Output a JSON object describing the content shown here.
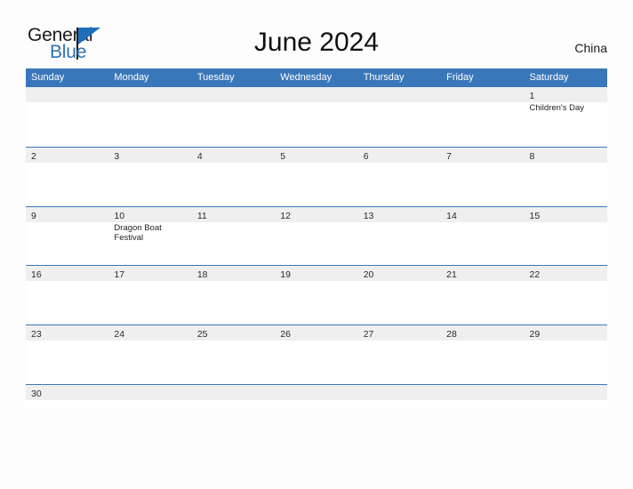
{
  "brand": {
    "name_part1": "General",
    "name_part2": "Blue",
    "triangle_icon": "triangle-icon"
  },
  "header": {
    "title": "June 2024",
    "country": "China"
  },
  "colors": {
    "header_blue": "#3a77ba",
    "brand_blue": "#2e72b5",
    "band_gray": "#efefef",
    "page_background": "#fdfdfd"
  },
  "calendar": {
    "weekdays": [
      "Sunday",
      "Monday",
      "Tuesday",
      "Wednesday",
      "Thursday",
      "Friday",
      "Saturday"
    ],
    "weeks": [
      [
        {
          "date": "",
          "events": []
        },
        {
          "date": "",
          "events": []
        },
        {
          "date": "",
          "events": []
        },
        {
          "date": "",
          "events": []
        },
        {
          "date": "",
          "events": []
        },
        {
          "date": "",
          "events": []
        },
        {
          "date": "1",
          "events": [
            "Children's Day"
          ]
        }
      ],
      [
        {
          "date": "2",
          "events": []
        },
        {
          "date": "3",
          "events": []
        },
        {
          "date": "4",
          "events": []
        },
        {
          "date": "5",
          "events": []
        },
        {
          "date": "6",
          "events": []
        },
        {
          "date": "7",
          "events": []
        },
        {
          "date": "8",
          "events": []
        }
      ],
      [
        {
          "date": "9",
          "events": []
        },
        {
          "date": "10",
          "events": [
            "Dragon Boat Festival"
          ]
        },
        {
          "date": "11",
          "events": []
        },
        {
          "date": "12",
          "events": []
        },
        {
          "date": "13",
          "events": []
        },
        {
          "date": "14",
          "events": []
        },
        {
          "date": "15",
          "events": []
        }
      ],
      [
        {
          "date": "16",
          "events": []
        },
        {
          "date": "17",
          "events": []
        },
        {
          "date": "18",
          "events": []
        },
        {
          "date": "19",
          "events": []
        },
        {
          "date": "20",
          "events": []
        },
        {
          "date": "21",
          "events": []
        },
        {
          "date": "22",
          "events": []
        }
      ],
      [
        {
          "date": "23",
          "events": []
        },
        {
          "date": "24",
          "events": []
        },
        {
          "date": "25",
          "events": []
        },
        {
          "date": "26",
          "events": []
        },
        {
          "date": "27",
          "events": []
        },
        {
          "date": "28",
          "events": []
        },
        {
          "date": "29",
          "events": []
        }
      ],
      [
        {
          "date": "30",
          "events": []
        },
        {
          "date": "",
          "events": []
        },
        {
          "date": "",
          "events": []
        },
        {
          "date": "",
          "events": []
        },
        {
          "date": "",
          "events": []
        },
        {
          "date": "",
          "events": []
        },
        {
          "date": "",
          "events": []
        }
      ]
    ]
  }
}
